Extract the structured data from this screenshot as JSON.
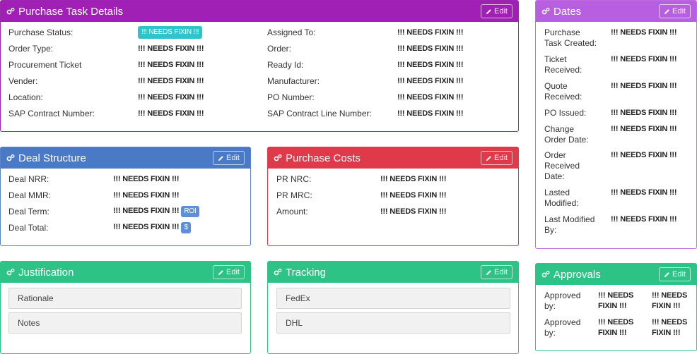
{
  "colors": {
    "purple": "#a020b5",
    "violet": "#b85ee0",
    "blue": "#4a7ac6",
    "red": "#e03a4a",
    "green": "#2ec386",
    "badge_cyan": "#2ec4c9",
    "badge_blue": "#5f8fd6"
  },
  "icons": {
    "panel": "gears-icon",
    "edit": "pencil-icon"
  },
  "edit_label": "Edit",
  "purchase": {
    "title": "Purchase Task Details",
    "left": [
      {
        "label": "Purchase Status:",
        "value": "!!! NEEDS FIXIN !!!"
      },
      {
        "label": "Order Type:",
        "value": "!!! NEEDS FIXIN !!!"
      },
      {
        "label": "Procurement Ticket",
        "value": "!!! NEEDS FIXIN !!!"
      },
      {
        "label": "Vender:",
        "value": "!!! NEEDS FIXIN !!!"
      },
      {
        "label": "Location:",
        "value": "!!! NEEDS FIXIN !!!"
      },
      {
        "label": "SAP Contract Number:",
        "value": "!!! NEEDS FIXIN !!!"
      }
    ],
    "right": [
      {
        "label": "Assigned To:",
        "value": "!!! NEEDS FIXIN !!!"
      },
      {
        "label": "Order:",
        "value": "!!! NEEDS FIXIN !!!"
      },
      {
        "label": "Ready Id:",
        "value": "!!! NEEDS FIXIN !!!"
      },
      {
        "label": "Manufacturer:",
        "value": "!!! NEEDS FIXIN !!!"
      },
      {
        "label": "PO Number:",
        "value": "!!! NEEDS FIXIN !!!"
      },
      {
        "label": "SAP Contract Line Number:",
        "value": "!!! NEEDS FIXIN !!!"
      }
    ]
  },
  "dates": {
    "title": "Dates",
    "rows": [
      {
        "label_lines": [
          "Purchase",
          "Task Created:"
        ],
        "value": "!!! NEEDS FIXIN !!!"
      },
      {
        "label_lines": [
          "Ticket",
          "Received:"
        ],
        "value": "!!! NEEDS FIXIN !!!"
      },
      {
        "label_lines": [
          "Quote",
          "Received:"
        ],
        "value": "!!! NEEDS FIXIN !!!"
      },
      {
        "label_lines": [
          "PO Issued:"
        ],
        "value": "!!! NEEDS FIXIN !!!"
      },
      {
        "label_lines": [
          "Change",
          "Order Date:"
        ],
        "value": "!!! NEEDS FIXIN !!!"
      },
      {
        "label_lines": [
          "Order",
          "Received",
          "Date:"
        ],
        "value": "!!! NEEDS FIXIN !!!"
      },
      {
        "label_lines": [
          "Lasted",
          "Modified:"
        ],
        "value": "!!! NEEDS FIXIN !!!"
      },
      {
        "label_lines": [
          "Last Modified",
          "By:"
        ],
        "value": "!!! NEEDS FIXIN !!!"
      }
    ]
  },
  "deal": {
    "title": "Deal Structure",
    "rows": [
      {
        "label": "Deal NRR:",
        "value": "!!! NEEDS FIXIN !!!",
        "badge": ""
      },
      {
        "label": "Deal MMR:",
        "value": "!!! NEEDS FIXIN !!!",
        "badge": ""
      },
      {
        "label": "Deal Term:",
        "value": "!!! NEEDS FIXIN !!!",
        "badge": "ROI"
      },
      {
        "label": "Deal Total:",
        "value": "!!! NEEDS FIXIN !!!",
        "badge": "$"
      }
    ]
  },
  "costs": {
    "title": "Purchase Costs",
    "rows": [
      {
        "label": "PR NRC:",
        "value": "!!! NEEDS FIXIN !!!"
      },
      {
        "label": "PR MRC:",
        "value": "!!! NEEDS FIXIN !!!"
      },
      {
        "label": "Amount:",
        "value": "!!! NEEDS FIXIN !!!"
      }
    ]
  },
  "justification": {
    "title": "Justification",
    "items": [
      "Rationale",
      "Notes"
    ]
  },
  "tracking": {
    "title": "Tracking",
    "items": [
      "FedEx",
      "DHL"
    ]
  },
  "approvals": {
    "title": "Approvals",
    "rows": [
      {
        "label_lines": [
          "Approved",
          "by:"
        ],
        "value1_lines": [
          "!!! NEEDS",
          "FIXIN !!!"
        ],
        "value2_lines": [
          "!!! NEEDS",
          "FIXIN !!!"
        ]
      },
      {
        "label_lines": [
          "Approved",
          "by:"
        ],
        "value1_lines": [
          "!!! NEEDS",
          "FIXIN !!!"
        ],
        "value2_lines": [
          "!!! NEEDS",
          "FIXIN !!!"
        ]
      }
    ]
  }
}
